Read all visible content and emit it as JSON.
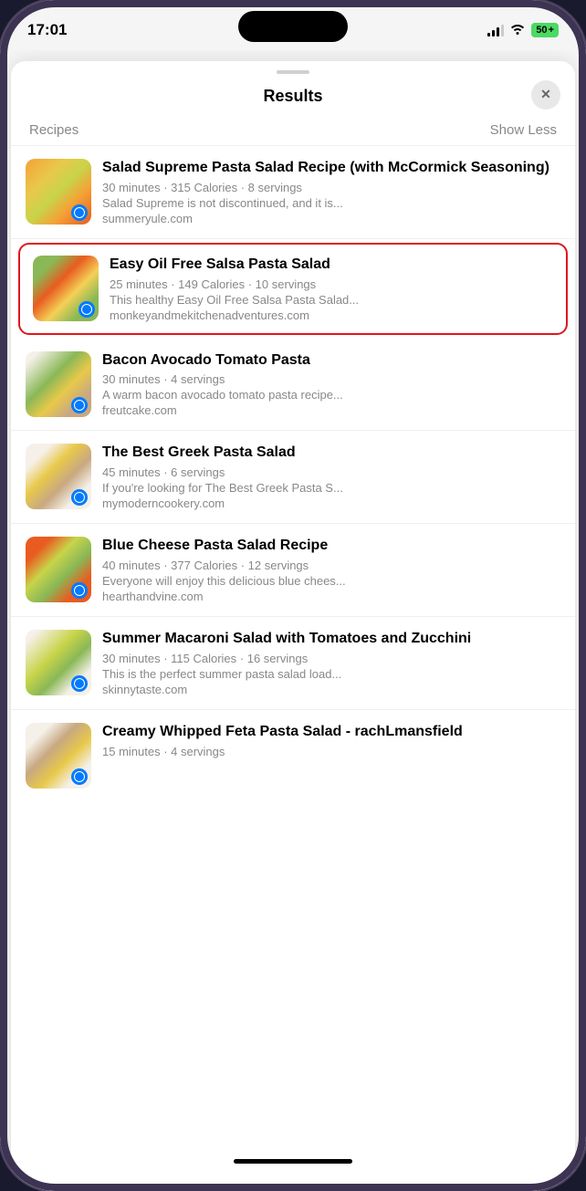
{
  "statusBar": {
    "time": "17:01",
    "battery": "50",
    "batterySymbol": "+"
  },
  "modal": {
    "title": "Results",
    "closeLabel": "✕",
    "sectionLabel": "Recipes",
    "showLessLabel": "Show Less"
  },
  "recipes": [
    {
      "id": "salad-supreme",
      "title": "Salad Supreme Pasta Salad Recipe (with McCormick Seasoning)",
      "meta": "30 minutes · 315 Calories · 8 servings",
      "desc": "Salad Supreme is not discontinued, and it is...",
      "source": "summeryule.com",
      "highlighted": false,
      "foodClass": "food-salad-supreme"
    },
    {
      "id": "easy-oil-free",
      "title": "Easy Oil Free Salsa Pasta Salad",
      "meta": "25 minutes · 149 Calories · 10 servings",
      "desc": "This healthy Easy Oil Free Salsa Pasta Salad...",
      "source": "monkeyandmekitchenadventures.com",
      "highlighted": true,
      "foodClass": "food-salsa-pasta"
    },
    {
      "id": "bacon-avocado",
      "title": "Bacon Avocado Tomato Pasta",
      "meta": "30 minutes · 4 servings",
      "desc": "A warm bacon avocado tomato pasta recipe...",
      "source": "freutcake.com",
      "highlighted": false,
      "foodClass": "food-bacon-avocado"
    },
    {
      "id": "greek-pasta",
      "title": "The Best Greek Pasta Salad",
      "meta": "45 minutes · 6 servings",
      "desc": "If you're looking for The Best Greek Pasta S...",
      "source": "mymoderncookery.com",
      "highlighted": false,
      "foodClass": "food-greek-pasta"
    },
    {
      "id": "blue-cheese",
      "title": "Blue Cheese Pasta Salad Recipe",
      "meta": "40 minutes · 377 Calories · 12 servings",
      "desc": "Everyone will enjoy this delicious blue chees...",
      "source": "hearthandvine.com",
      "highlighted": false,
      "foodClass": "food-blue-cheese"
    },
    {
      "id": "summer-mac",
      "title": "Summer Macaroni Salad with Tomatoes and Zucchini",
      "meta": "30 minutes · 115 Calories · 16 servings",
      "desc": "This is the perfect summer pasta salad load...",
      "source": "skinnytaste.com",
      "highlighted": false,
      "foodClass": "food-summer-mac"
    },
    {
      "id": "whipped-feta",
      "title": "Creamy Whipped Feta Pasta Salad - rachLmansfield",
      "meta": "15 minutes · 4 servings",
      "desc": "",
      "source": "",
      "highlighted": false,
      "foodClass": "food-whipped-feta"
    }
  ]
}
